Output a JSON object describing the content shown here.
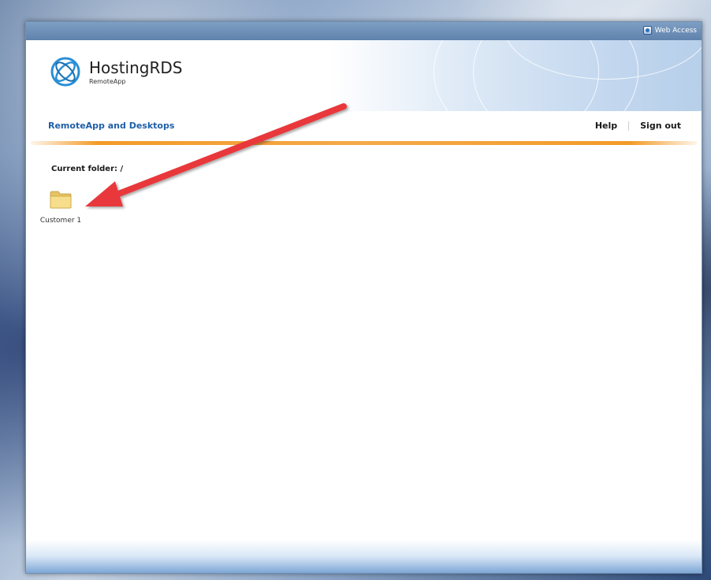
{
  "header": {
    "web_access_label": "Web Access",
    "brand_name": "HostingRDS",
    "brand_sub": "RemoteApp"
  },
  "nav": {
    "title": "RemoteApp and Desktops",
    "help_label": "Help",
    "signout_label": "Sign out"
  },
  "content": {
    "current_folder_label": "Current folder: /",
    "folders": [
      {
        "label": "Customer 1",
        "icon": "folder-icon"
      }
    ]
  },
  "colors": {
    "accent_blue": "#1f5fa8",
    "orange_divider": "#f29b28",
    "annotation_arrow": "#e8393a"
  }
}
